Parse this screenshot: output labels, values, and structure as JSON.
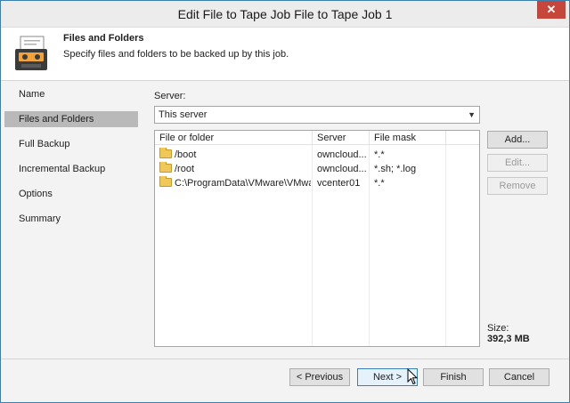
{
  "window": {
    "title": "Edit File to Tape Job File to Tape Job 1",
    "close_label": "✕"
  },
  "header": {
    "title": "Files and Folders",
    "description": "Specify files and folders to be backed up by this job.",
    "icon": "tape-cassette-icon"
  },
  "nav": {
    "items": [
      {
        "label": "Name"
      },
      {
        "label": "Files and Folders"
      },
      {
        "label": "Full Backup"
      },
      {
        "label": "Incremental Backup"
      },
      {
        "label": "Options"
      },
      {
        "label": "Summary"
      }
    ],
    "active_index": 1
  },
  "server": {
    "label": "Server:",
    "value": "This server"
  },
  "table": {
    "columns": [
      "File or folder",
      "Server",
      "File mask"
    ],
    "rows": [
      {
        "path": "/boot",
        "server": "owncloud...",
        "mask": "*.*"
      },
      {
        "path": "/root",
        "server": "owncloud...",
        "mask": "*.sh; *.log"
      },
      {
        "path": "C:\\ProgramData\\VMware\\VMwa...",
        "server": "vcenter01",
        "mask": "*.*"
      }
    ]
  },
  "side_buttons": {
    "add": "Add...",
    "edit": "Edit...",
    "remove": "Remove"
  },
  "size": {
    "label": "Size:",
    "value": "392,3 MB"
  },
  "footer": {
    "previous": "< Previous",
    "next": "Next >",
    "finish": "Finish",
    "cancel": "Cancel"
  },
  "colors": {
    "accent": "#3c7fb1",
    "close": "#c7463b",
    "folder": "#f0c75a",
    "nav_active": "#b9b9b9"
  }
}
